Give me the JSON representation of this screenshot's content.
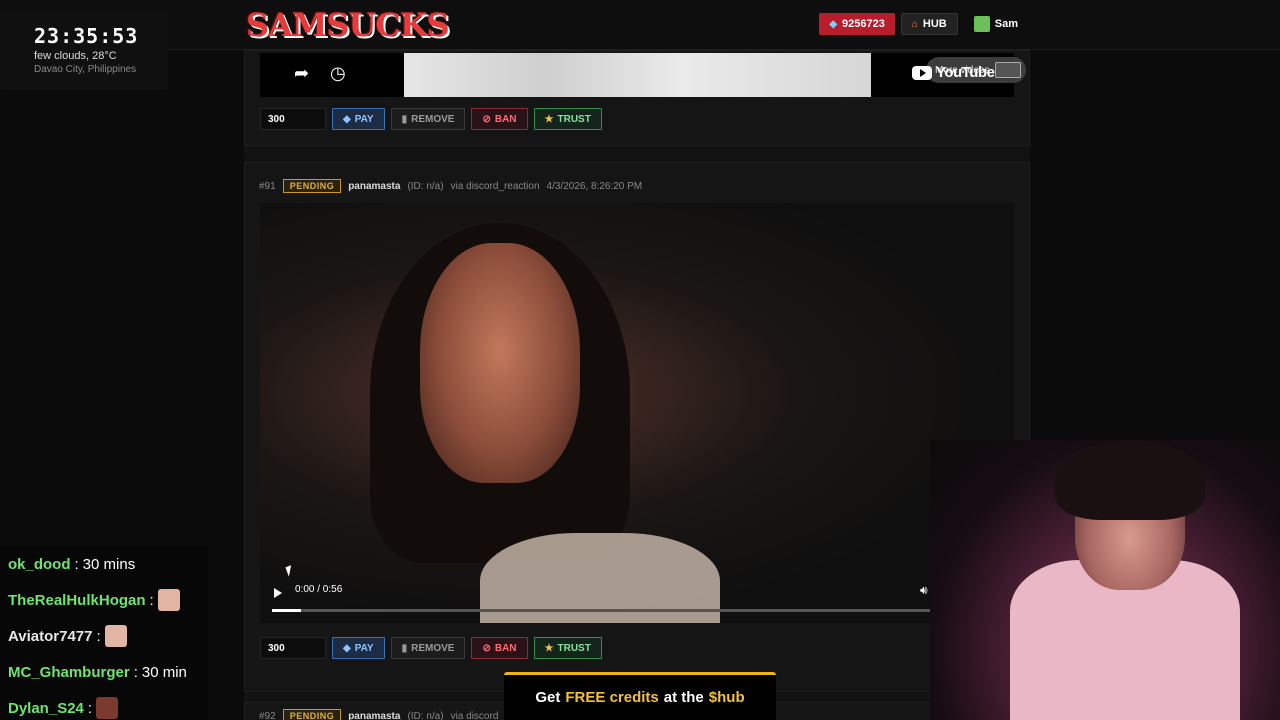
{
  "header": {
    "logo_text": "SAMSUCKS",
    "credits": "9256723",
    "hub_label": "HUB",
    "user_name": "Sam"
  },
  "clock": {
    "time": "23:35:53",
    "weather": "few clouds, 28°C",
    "location": "Davao City, Philippines"
  },
  "embed": {
    "more_videos_label": "More videos",
    "youtube_label": "YouTube"
  },
  "card1": {
    "amount": "300",
    "pay_label": "PAY",
    "remove_label": "REMOVE",
    "ban_label": "BAN",
    "trust_label": "TRUST"
  },
  "card2": {
    "id": "#91",
    "status": "PENDING",
    "username": "panamasta",
    "user_id": "(ID: n/a)",
    "source": "via discord_reaction",
    "timestamp": "4/3/2026, 8:26:20 PM",
    "video_time": "0:00 / 0:56",
    "progress_fraction": 0.04,
    "amount": "300",
    "pay_label": "PAY",
    "remove_label": "REMOVE",
    "ban_label": "BAN",
    "trust_label": "TRUST"
  },
  "card3": {
    "id": "#92",
    "status": "PENDING",
    "username": "panamasta",
    "user_id": "(ID: n/a)",
    "source": "via discord_reaction"
  },
  "chat": [
    {
      "name": "ok_dood",
      "message": "30 mins",
      "color": "green"
    },
    {
      "name": "TheRealHulkHogan",
      "message": "",
      "color": "green",
      "emote": true
    },
    {
      "name": "Aviator7477",
      "message": "",
      "color": "white",
      "emote": true
    },
    {
      "name": "MC_Ghamburger",
      "message": "30 min",
      "color": "green"
    },
    {
      "name": "Dylan_S24",
      "message": "",
      "color": "green",
      "emote": true
    }
  ],
  "banner": {
    "prefix": "Get",
    "highlight1": "FREE credits",
    "middle": "at the",
    "highlight2": "$hub"
  },
  "colors": {
    "accent_red": "#b81d2b",
    "pending_yellow": "#e0b13a",
    "pay_blue": "#8cc4ff",
    "trust_green": "#86e39d",
    "ban_red": "#ff6b75"
  }
}
